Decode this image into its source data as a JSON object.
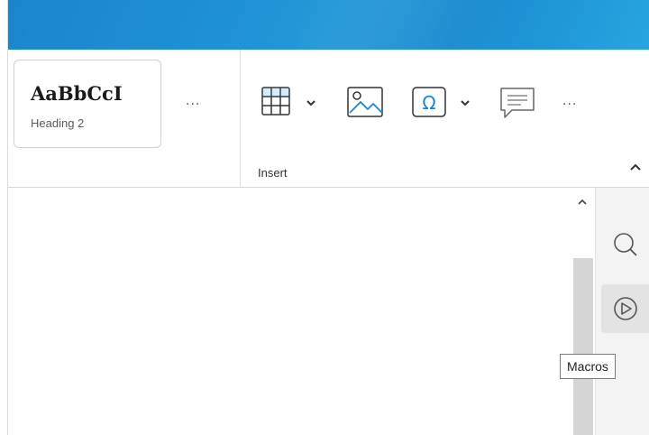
{
  "ribbon": {
    "style_gallery": {
      "sample": "AaBbCcI",
      "style_name": "Heading 2",
      "more_label": "···"
    },
    "insert_group": {
      "label": "Insert",
      "more_label": "···",
      "tools": [
        "table-icon",
        "image-icon",
        "special-character-icon",
        "comment-icon"
      ]
    }
  },
  "side_panel": {
    "tooltip": "Macros",
    "buttons": [
      "search-icon",
      "macros-icon"
    ]
  },
  "colors": {
    "titlebar": "#1e8fd4",
    "accent": "#1e88d6",
    "scroll_thumb": "#d5d5d5"
  }
}
